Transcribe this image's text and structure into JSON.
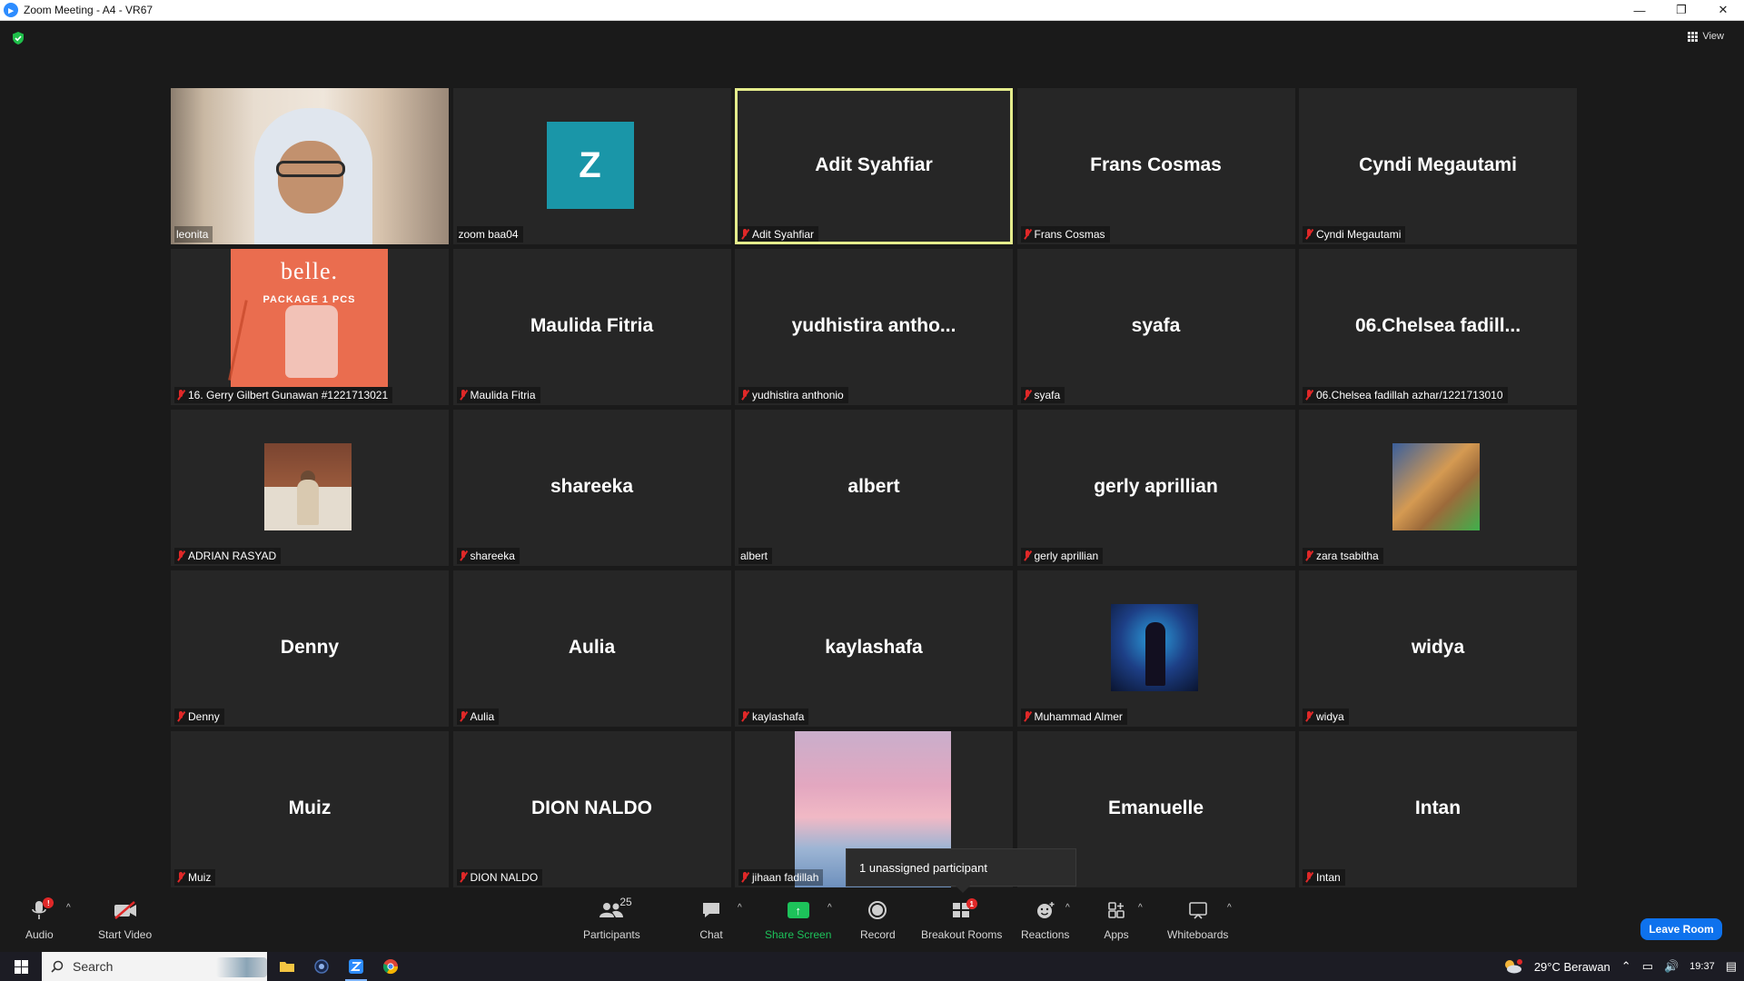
{
  "window": {
    "title": "Zoom Meeting - A4 - VR67"
  },
  "top": {
    "view_label": "View"
  },
  "tiles": [
    {
      "big": "",
      "label": "leonita",
      "muted": false,
      "kind": "video-leonita"
    },
    {
      "big": "",
      "label": "zoom baa04",
      "muted": false,
      "kind": "avatar-z",
      "avatar_letter": "Z"
    },
    {
      "big": "Adit Syahfiar",
      "label": "Adit Syahfiar",
      "muted": true,
      "kind": "name",
      "active": true
    },
    {
      "big": "Frans Cosmas",
      "label": "Frans Cosmas",
      "muted": true,
      "kind": "name"
    },
    {
      "big": "Cyndi Megautami",
      "label": "Cyndi Megautami",
      "muted": true,
      "kind": "name"
    },
    {
      "big": "",
      "label": "16. Gerry Gilbert Gunawan #1221713021",
      "muted": true,
      "kind": "img-belle",
      "img_text1": "belle.",
      "img_text2": "PACKAGE 1 PCS"
    },
    {
      "big": "Maulida Fitria",
      "label": "Maulida Fitria",
      "muted": true,
      "kind": "name"
    },
    {
      "big": "yudhistira antho...",
      "label": "yudhistira anthonio",
      "muted": true,
      "kind": "name"
    },
    {
      "big": "syafa",
      "label": "syafa",
      "muted": true,
      "kind": "name"
    },
    {
      "big": "06.Chelsea fadill...",
      "label": "06.Chelsea fadillah azhar/1221713010",
      "muted": true,
      "kind": "name"
    },
    {
      "big": "",
      "label": "ADRIAN RASYAD",
      "muted": true,
      "kind": "img-adrian"
    },
    {
      "big": "shareeka",
      "label": "shareeka",
      "muted": true,
      "kind": "name"
    },
    {
      "big": "albert",
      "label": "albert",
      "muted": false,
      "kind": "name"
    },
    {
      "big": "gerly aprillian",
      "label": "gerly aprillian",
      "muted": true,
      "kind": "name"
    },
    {
      "big": "",
      "label": "zara tsabitha",
      "muted": true,
      "kind": "img-zara"
    },
    {
      "big": "Denny",
      "label": "Denny",
      "muted": true,
      "kind": "name"
    },
    {
      "big": "Aulia",
      "label": "Aulia",
      "muted": true,
      "kind": "name"
    },
    {
      "big": "kaylashafa",
      "label": "kaylashafa",
      "muted": true,
      "kind": "name"
    },
    {
      "big": "",
      "label": "Muhammad Almer",
      "muted": true,
      "kind": "img-almer"
    },
    {
      "big": "widya",
      "label": "widya",
      "muted": true,
      "kind": "name"
    },
    {
      "big": "Muiz",
      "label": "Muiz",
      "muted": true,
      "kind": "name"
    },
    {
      "big": "DION NALDO",
      "label": "DION NALDO",
      "muted": true,
      "kind": "name"
    },
    {
      "big": "",
      "label": "jihaan fadillah",
      "muted": true,
      "kind": "img-sky"
    },
    {
      "big": "Emanuelle",
      "label": "lle",
      "muted": false,
      "kind": "name"
    },
    {
      "big": "Intan",
      "label": "Intan",
      "muted": true,
      "kind": "name"
    }
  ],
  "tooltip": {
    "text": "1 unassigned participant"
  },
  "toolbar": {
    "audio": "Audio",
    "audio_badge": "!",
    "start_video": "Start Video",
    "participants": "Participants",
    "participants_count": "25",
    "chat": "Chat",
    "share_screen": "Share Screen",
    "record": "Record",
    "breakout_rooms": "Breakout Rooms",
    "breakout_badge": "1",
    "reactions": "Reactions",
    "apps": "Apps",
    "whiteboards": "Whiteboards",
    "leave": "Leave Room"
  },
  "taskbar": {
    "search_placeholder": "Search",
    "weather": "29°C Berawan",
    "time": "19:37"
  },
  "colors": {
    "active_speaker": "#e4ec8c",
    "leave": "#0e72ed",
    "share": "#1dc25a",
    "muted": "#e02828"
  }
}
